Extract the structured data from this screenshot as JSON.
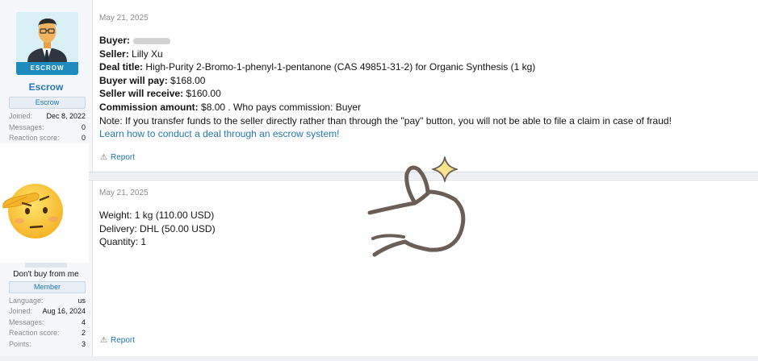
{
  "post1": {
    "date": "May 21, 2025",
    "user": {
      "avatar_band": "ESCROW",
      "name": "Escrow",
      "banner": "Escrow",
      "stats": [
        {
          "label": "Joined:",
          "value": "Dec 8, 2022"
        },
        {
          "label": "Messages:",
          "value": "0"
        },
        {
          "label": "Reaction score:",
          "value": "0"
        }
      ]
    },
    "lines": {
      "buyer_label": "Buyer:",
      "seller_label": "Seller:",
      "seller": "Lilly Xu",
      "deal_label": "Deal title:",
      "deal": "High-Purity 2-Bromo-1-phenyl-1-pentanone (CAS 49851-31-2) for Organic Synthesis (1 kg)",
      "pay_label": "Buyer will pay:",
      "pay": "$168.00",
      "receive_label": "Seller will receive:",
      "receive": "$160.00",
      "commission_label": "Commission amount:",
      "commission": "$8.00 . Who pays commission: Buyer",
      "note": "Note: If you transfer funds to the seller directly rather than through the \"pay\" button, you will not be able to file a claim in case of fraud!",
      "link": "Learn how to conduct a deal through an escrow system!"
    },
    "report": "Report"
  },
  "post2": {
    "date": "May 21, 2025",
    "user": {
      "title": "Don't buy from me",
      "banner": "Member",
      "stats": [
        {
          "label": "Language:",
          "value": "us"
        },
        {
          "label": "Joined:",
          "value": "Aug 16, 2024"
        },
        {
          "label": "Messages:",
          "value": "4"
        },
        {
          "label": "Reaction score:",
          "value": "2"
        },
        {
          "label": "Points:",
          "value": "3"
        }
      ]
    },
    "lines": {
      "weight": "Weight: 1 kg (110.00 USD)",
      "delivery": "Delivery: DHL (50.00 USD)",
      "quantity": "Quantity: 1"
    },
    "report": "Report"
  },
  "icons": [
    "saluting-face-emoji",
    "thumbs-up-sticker",
    "sparkle-icon",
    "warning-triangle-icon",
    "escrow-avatar"
  ],
  "colors": {
    "link": "#2577b1",
    "muted": "#8c8c8c",
    "banner_bg": "#e7eef5",
    "avatar_band": "#1e8bbf"
  }
}
